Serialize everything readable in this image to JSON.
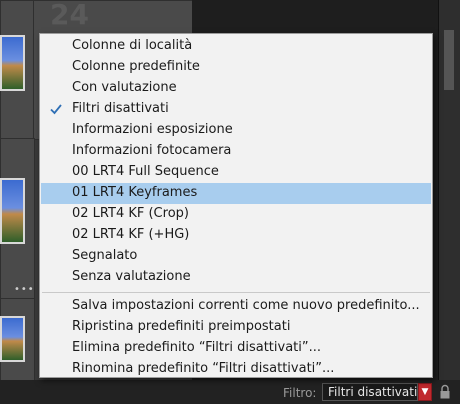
{
  "background": {
    "cell_number": "24"
  },
  "menu": {
    "items": [
      {
        "label": "Colonne di località",
        "checked": false,
        "highlighted": false
      },
      {
        "label": "Colonne predefinite",
        "checked": false,
        "highlighted": false
      },
      {
        "label": "Con valutazione",
        "checked": false,
        "highlighted": false
      },
      {
        "label": "Filtri disattivati",
        "checked": true,
        "highlighted": false
      },
      {
        "label": "Informazioni esposizione",
        "checked": false,
        "highlighted": false
      },
      {
        "label": "Informazioni fotocamera",
        "checked": false,
        "highlighted": false
      },
      {
        "label": "00 LRT4 Full Sequence",
        "checked": false,
        "highlighted": false
      },
      {
        "label": "01 LRT4 Keyframes",
        "checked": false,
        "highlighted": true
      },
      {
        "label": "02 LRT4 KF (Crop)",
        "checked": false,
        "highlighted": false
      },
      {
        "label": "02 LRT4 KF (+HG)",
        "checked": false,
        "highlighted": false
      },
      {
        "label": "Segnalato",
        "checked": false,
        "highlighted": false
      },
      {
        "label": "Senza valutazione",
        "checked": false,
        "highlighted": false
      }
    ],
    "actions": [
      {
        "label": "Salva impostazioni correnti come nuovo predefinito..."
      },
      {
        "label": "Ripristina predefiniti preimpostati"
      },
      {
        "label": "Elimina predefinito “Filtri disattivati”..."
      },
      {
        "label": "Rinomina predefinito “Filtri disattivati”..."
      }
    ]
  },
  "filter_bar": {
    "label": "Filtro:",
    "selected": "Filtri disattivati"
  },
  "colors": {
    "highlight": "#a8cdee",
    "check": "#2f6fb5",
    "dropdown_arrow": "#c0282d"
  }
}
